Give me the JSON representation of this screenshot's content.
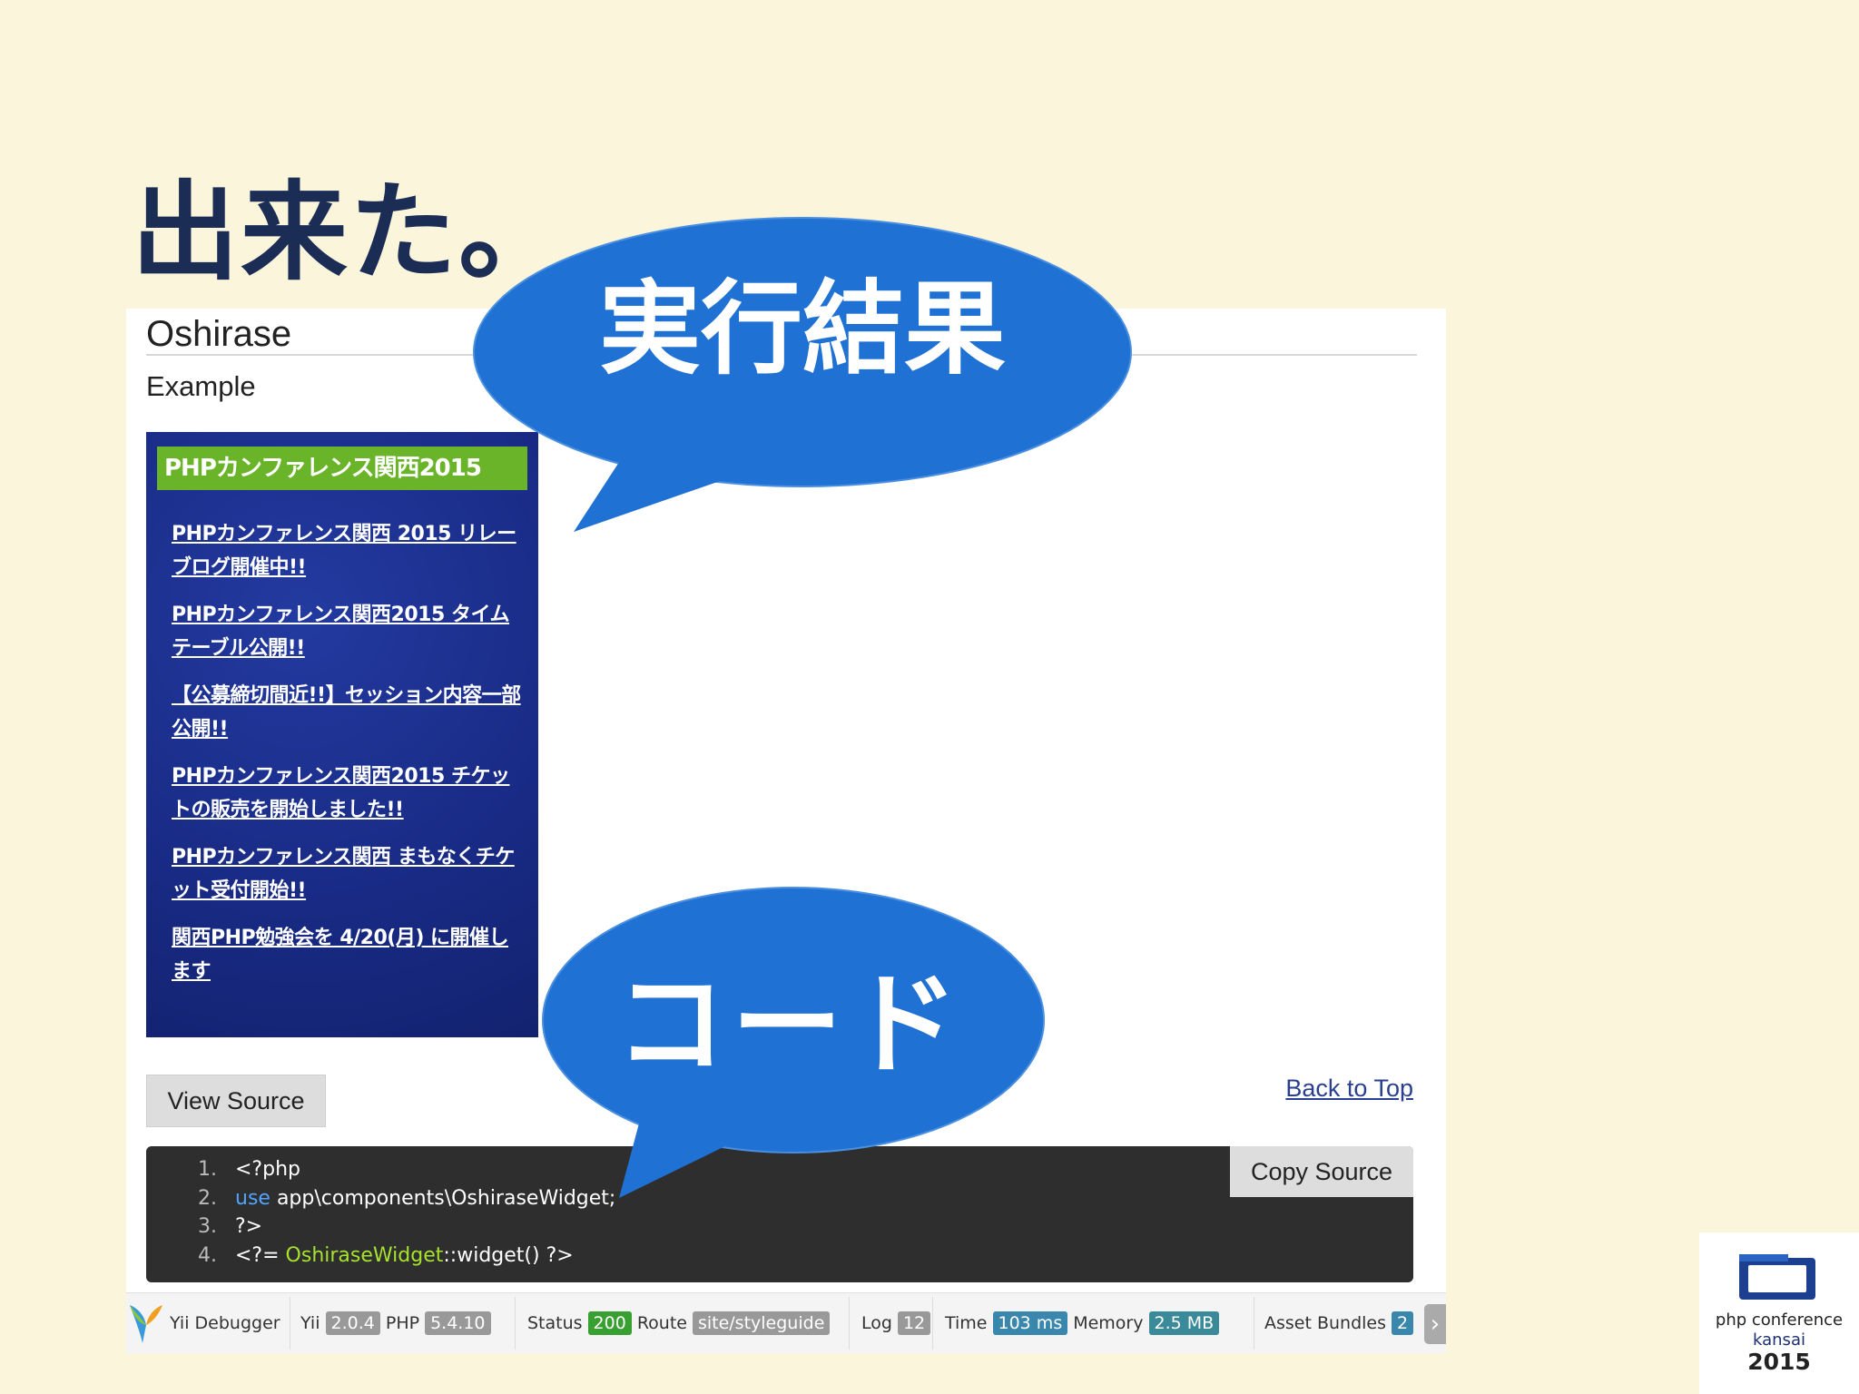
{
  "slide": {
    "title": "出来た。"
  },
  "page": {
    "title": "Oshirase",
    "subtitle": "Example"
  },
  "widget": {
    "header": "PHPカンファレンス関西2015",
    "items": [
      "PHPカンファレンス関西 2015 リレーブログ開催中!!",
      "PHPカンファレンス関西2015 タイムテーブル公開!!",
      "【公募締切間近!!】セッション内容一部公開!!",
      "PHPカンファレンス関西2015 チケットの販売を開始しました!!",
      "PHPカンファレンス関西 まもなくチケット受付開始!!",
      "関西PHP勉強会を 4/20(月) に開催します"
    ]
  },
  "buttons": {
    "view_source": "View Source",
    "back_to_top": "Back to Top",
    "copy_source": "Copy Source"
  },
  "code": {
    "line_numbers": [
      "1.",
      "2.",
      "3.",
      "4."
    ],
    "line1": "<?php",
    "line2_kw": "use",
    "line2_rest": " app\\components\\OshiraseWidget;",
    "line3": "?>",
    "line4_open": "<?= ",
    "line4_class": "OshiraseWidget",
    "line4_sep": "::",
    "line4_rest": "widget() ?>"
  },
  "debug_bar": {
    "name": "Yii Debugger",
    "yii_label": "Yii",
    "yii_version": "2.0.4",
    "php_label": "PHP",
    "php_version": "5.4.10",
    "status_label": "Status",
    "status_value": "200",
    "route_label": "Route",
    "route_value": "site/styleguide",
    "log_label": "Log",
    "log_value": "12",
    "time_label": "Time",
    "time_value": "103 ms",
    "memory_label": "Memory",
    "memory_value": "2.5 MB",
    "assets_label": "Asset Bundles",
    "assets_value": "2",
    "toggle_icon": "chevron-right-icon"
  },
  "callouts": {
    "result": "実行結果",
    "code": "コード",
    "color": "#2071d4"
  },
  "logo": {
    "line1": "php conference",
    "line2": "kansai",
    "line3": "2015"
  }
}
